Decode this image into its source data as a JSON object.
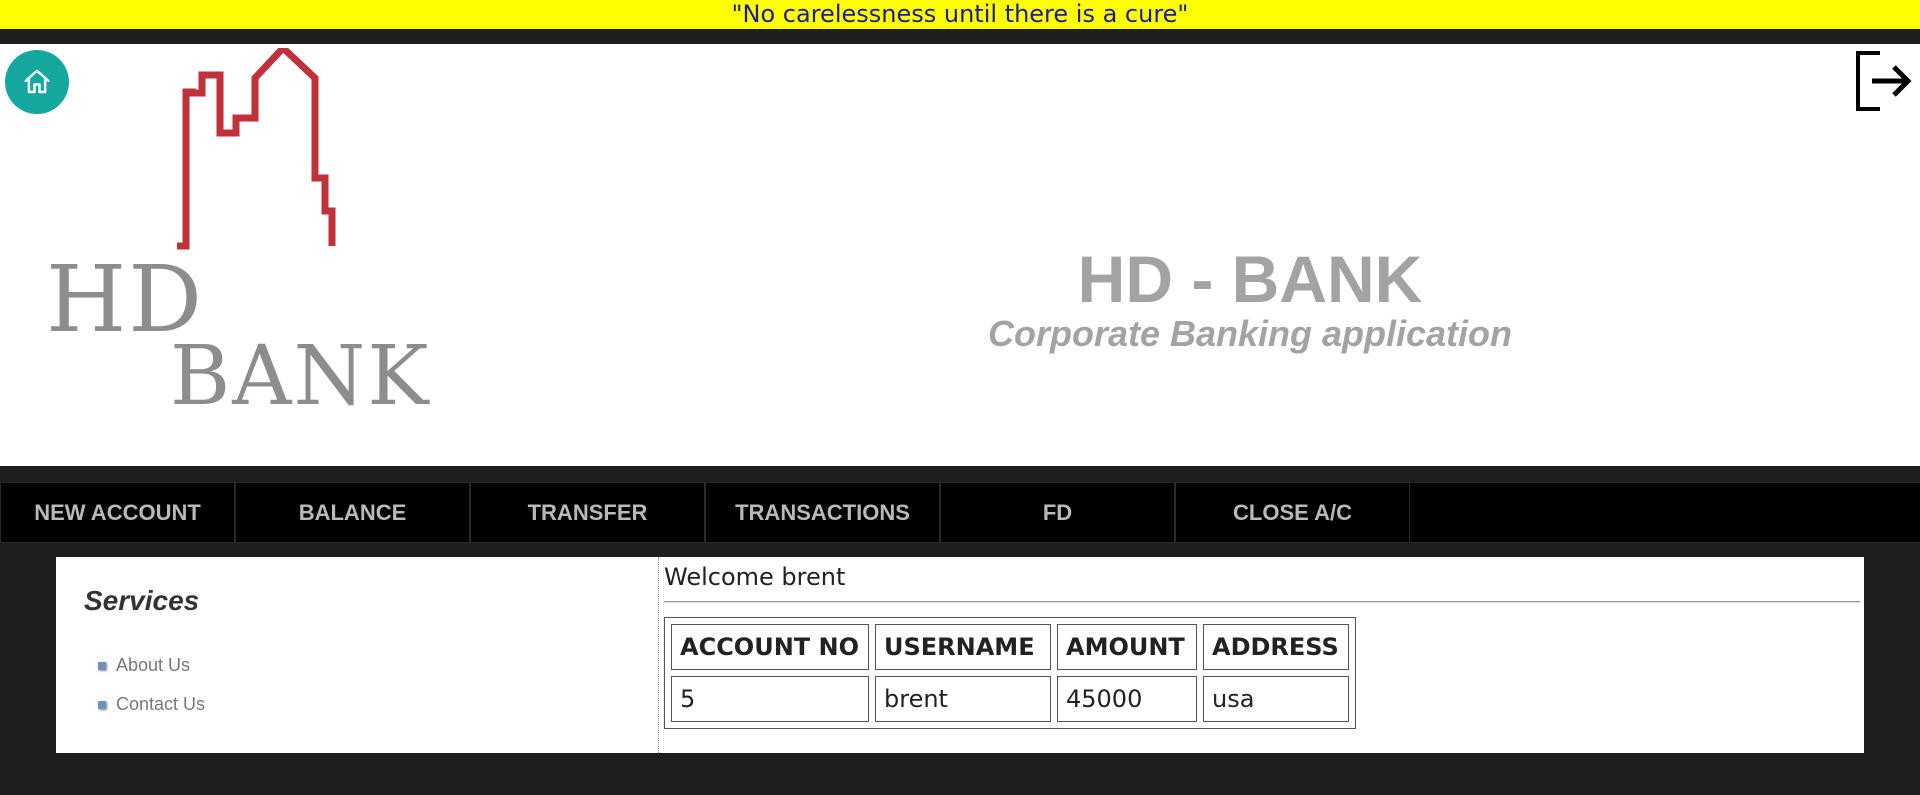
{
  "banner": {
    "text": "\"No carelessness until there is a cure\""
  },
  "header": {
    "logo_line1": "HD",
    "logo_line2": "BANK",
    "title": "HD - BANK",
    "subtitle": "Corporate Banking application",
    "home_icon": "home-icon",
    "logout_icon": "logout-icon"
  },
  "nav": {
    "items": [
      {
        "label": "NEW ACCOUNT"
      },
      {
        "label": "BALANCE"
      },
      {
        "label": "TRANSFER"
      },
      {
        "label": "TRANSACTIONS"
      },
      {
        "label": "FD"
      },
      {
        "label": "CLOSE A/C"
      }
    ]
  },
  "sidebar": {
    "title": "Services",
    "links": [
      {
        "label": "About Us"
      },
      {
        "label": "Contact Us"
      }
    ]
  },
  "main": {
    "welcome": "Welcome brent",
    "table": {
      "headers": [
        "ACCOUNT NO",
        "USERNAME",
        "AMOUNT",
        "ADDRESS"
      ],
      "rows": [
        [
          "5",
          "brent",
          "45000",
          "usa"
        ]
      ]
    }
  },
  "colors": {
    "banner_bg": "#ffff00",
    "banner_text": "#1c1c9c",
    "home_button": "#14a89e",
    "logo_red": "#c0323a",
    "page_bg": "#1e1e1e",
    "nav_bg": "#000000"
  }
}
